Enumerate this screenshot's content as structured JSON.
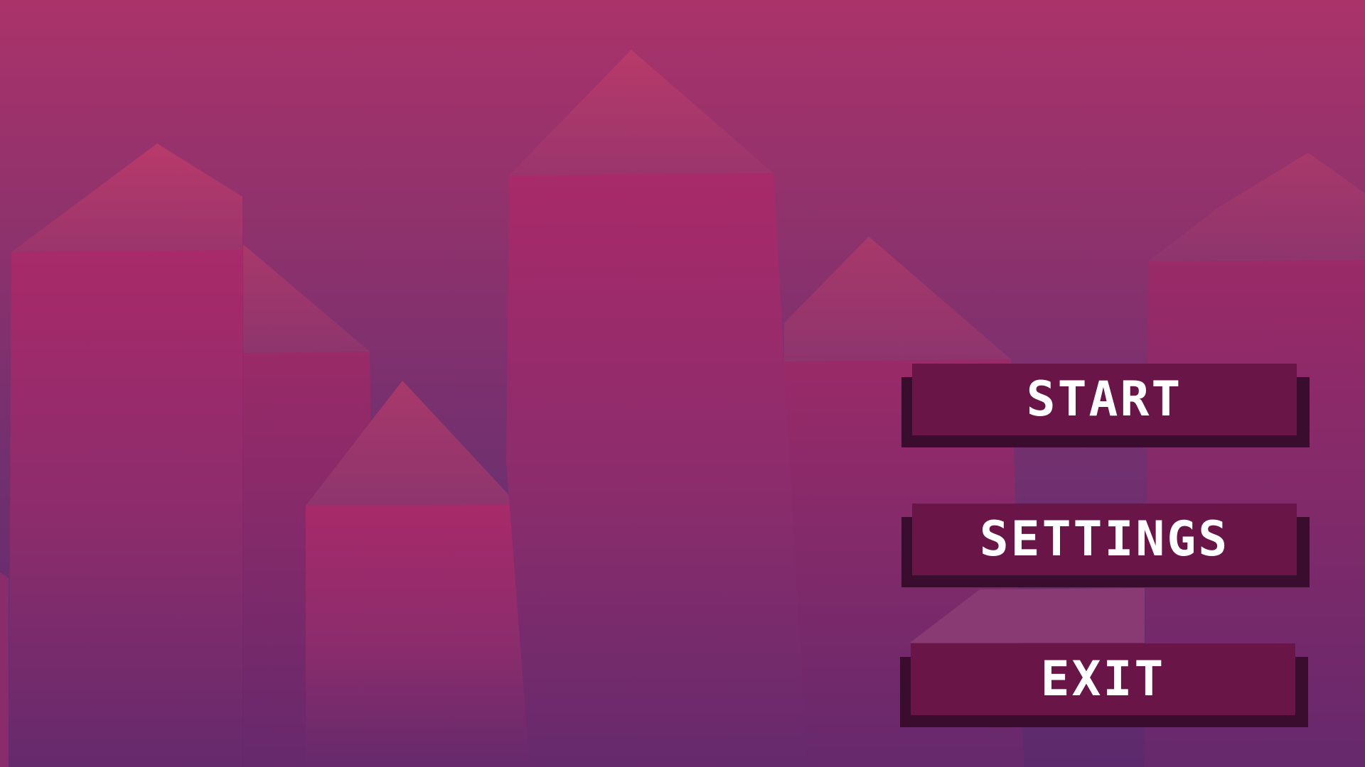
{
  "menu": {
    "start_label": "START",
    "settings_label": "SETTINGS",
    "exit_label": "EXIT"
  },
  "colors": {
    "sky_top": "#aa336a",
    "sky_bottom": "#5c2a6c",
    "button_face": "#6a1547",
    "button_shadow": "#3a0c2e",
    "button_text": "#ffffff"
  }
}
